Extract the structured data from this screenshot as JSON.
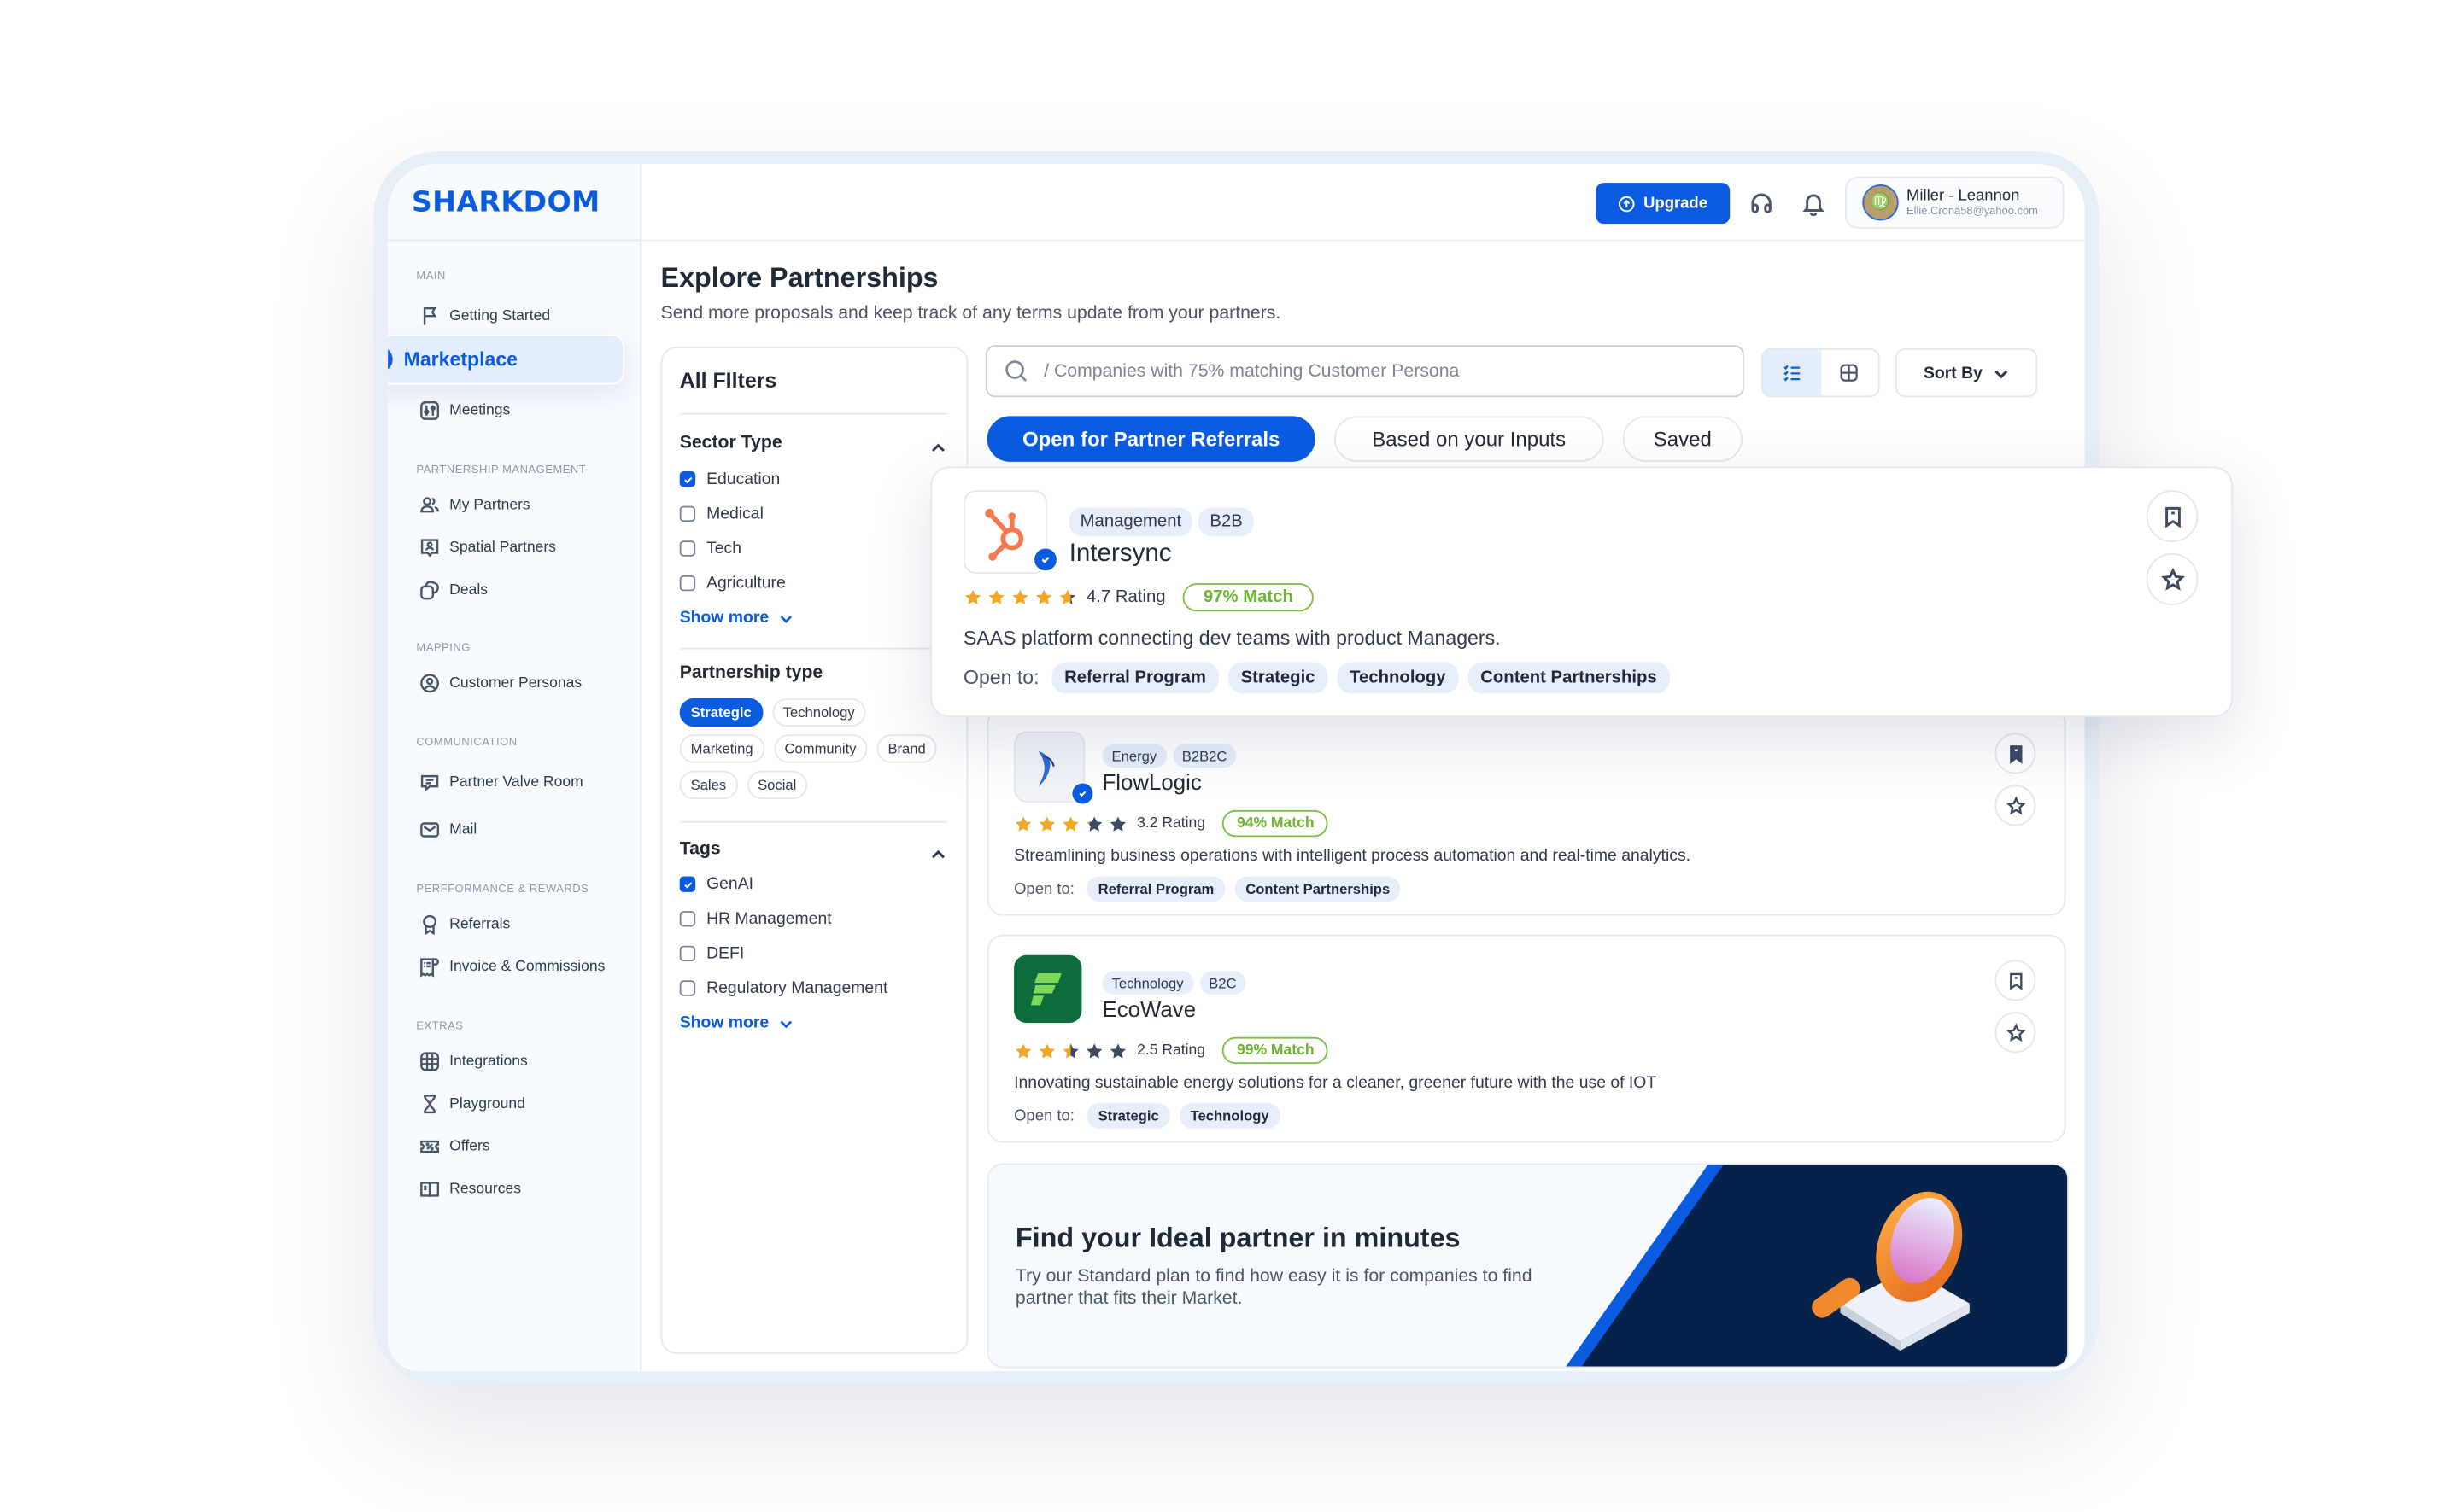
{
  "brand": {
    "name": "SHARKDOM",
    "color": "#0a5be0"
  },
  "topbar": {
    "upgrade_label": "Upgrade",
    "support_icon": "headphones-icon",
    "notifications_icon": "bell-icon",
    "user": {
      "name": "Miller - Leannon",
      "email": "Ellie.Crona58@yahoo.com",
      "avatar_glyph": "♍"
    }
  },
  "sidebar": {
    "sections": [
      {
        "label": "MAIN",
        "items": [
          {
            "label": "Getting Started",
            "icon": "flag-icon"
          },
          {
            "label": "Marketplace",
            "icon": "arrow-up-right-icon",
            "active": true
          },
          {
            "label": "Meetings",
            "icon": "sliders-icon"
          }
        ]
      },
      {
        "label": "PARTNERSHIP MANAGEMENT",
        "items": [
          {
            "label": "My Partners",
            "icon": "users-icon"
          },
          {
            "label": "Spatial Partners",
            "icon": "user-badge-icon"
          },
          {
            "label": "Deals",
            "icon": "deals-icon"
          }
        ]
      },
      {
        "label": "MAPPING",
        "items": [
          {
            "label": "Customer Personas",
            "icon": "user-circle-icon"
          }
        ]
      },
      {
        "label": "COMMUNICATION",
        "items": [
          {
            "label": "Partner Valve Room",
            "icon": "chat-icon"
          },
          {
            "label": "Mail",
            "icon": "mail-icon"
          }
        ]
      },
      {
        "label": "PERFFORMANCE & REWARDS",
        "items": [
          {
            "label": "Referrals",
            "icon": "award-icon"
          },
          {
            "label": "Invoice & Commissions",
            "icon": "receipt-icon"
          }
        ]
      },
      {
        "label": "EXTRAS",
        "items": [
          {
            "label": "Integrations",
            "icon": "grid-icon"
          },
          {
            "label": "Playground",
            "icon": "hourglass-icon"
          },
          {
            "label": "Offers",
            "icon": "ticket-icon"
          },
          {
            "label": "Resources",
            "icon": "book-icon"
          }
        ]
      }
    ]
  },
  "page": {
    "title": "Explore Partnerships",
    "subtitle": "Send more proposals and keep track of any terms update from your partners."
  },
  "filters": {
    "title": "All FIlters",
    "sector": {
      "heading": "Sector Type",
      "options": [
        {
          "label": "Education",
          "checked": true
        },
        {
          "label": "Medical",
          "checked": false
        },
        {
          "label": "Tech",
          "checked": false
        },
        {
          "label": "Agriculture",
          "checked": false
        }
      ],
      "show_more": "Show more"
    },
    "partnership": {
      "heading": "Partnership type",
      "chips": [
        {
          "label": "Strategic",
          "selected": true
        },
        {
          "label": "Technology",
          "selected": false
        },
        {
          "label": "Marketing",
          "selected": false
        },
        {
          "label": "Community",
          "selected": false
        },
        {
          "label": "Brand",
          "selected": false
        },
        {
          "label": "Sales",
          "selected": false
        },
        {
          "label": "Social",
          "selected": false
        }
      ]
    },
    "tags": {
      "heading": "Tags",
      "options": [
        {
          "label": "GenAI",
          "checked": true
        },
        {
          "label": "HR Management",
          "checked": false
        },
        {
          "label": "DEFI",
          "checked": false
        },
        {
          "label": "Regulatory Management",
          "checked": false
        }
      ],
      "show_more": "Show more"
    }
  },
  "search": {
    "placeholder": "/ Companies with 75% matching Customer Persona",
    "value": ""
  },
  "view_toggle": {
    "active": "list"
  },
  "sort": {
    "label": "Sort By"
  },
  "tabs": [
    {
      "label": "Open for Partner Referrals",
      "active": true
    },
    {
      "label": "Based on your Inputs",
      "active": false
    },
    {
      "label": "Saved",
      "active": false
    }
  ],
  "open_to_label": "Open to:",
  "companies": [
    {
      "name": "Intersync",
      "verified": true,
      "categories": [
        "Management",
        "B2B"
      ],
      "rating": 4.7,
      "rating_label": "4.7 Rating",
      "match": "97% Match",
      "description": "SAAS platform connecting dev teams with product Managers.",
      "open_to": [
        "Referral Program",
        "Strategic",
        "Technology",
        "Content Partnerships"
      ],
      "bookmarked": false,
      "logo": "hubspot-sprocket-logo",
      "logo_color": "#f5784f"
    },
    {
      "name": "FlowLogic",
      "verified": true,
      "categories": [
        "Energy",
        "B2B2C"
      ],
      "rating": 3.2,
      "rating_label": "3.2 Rating",
      "match": "94% Match",
      "description": "Streamlining business operations with intelligent process automation and real-time analytics.",
      "open_to": [
        "Referral Program",
        "Content Partnerships"
      ],
      "bookmarked": true,
      "logo": "swallow-logo",
      "logo_color": "#2c6bd6"
    },
    {
      "name": "EcoWave",
      "verified": false,
      "categories": [
        "Technology",
        "B2C"
      ],
      "rating": 2.5,
      "rating_label": "2.5 Rating",
      "match": "99% Match",
      "description": "Innovating sustainable energy solutions for a cleaner, greener future with the use of IOT",
      "open_to": [
        "Strategic",
        "Technology"
      ],
      "bookmarked": false,
      "logo": "green-f-logo",
      "logo_color": "#0d6b3c"
    }
  ],
  "banner": {
    "title": "Find your Ideal partner in minutes",
    "text": "Try our Standard plan to find how easy it is for companies to find partner that fits their Market.",
    "illustration": "magnifying-glass-illustration"
  },
  "colors": {
    "accent": "#0a5be0",
    "match_green": "#6bb52f",
    "star": "#f5a623",
    "star_empty": "#3d4a63"
  }
}
